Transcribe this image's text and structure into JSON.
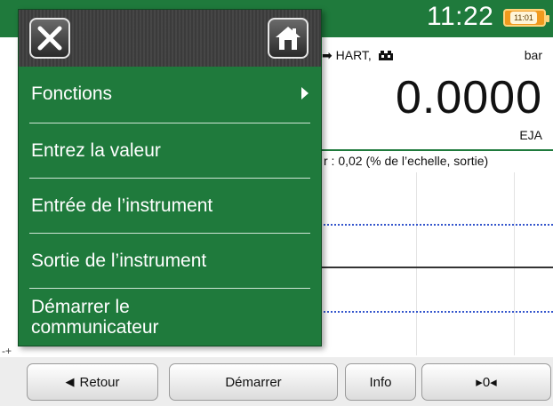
{
  "status": {
    "time": "11:22",
    "battery_label": "11:01",
    "accent_color": "#1f7a3c",
    "battery_color": "#f09a1e"
  },
  "measurement": {
    "protocol": "HART,",
    "unit": "bar",
    "value": "0.0000",
    "device": "EJA",
    "error_text": "r : 0,02 (% de l’echelle, sortie)"
  },
  "menu": {
    "close_icon": "close-icon",
    "home_icon": "home-icon",
    "items": [
      {
        "label": "Fonctions",
        "has_submenu": true
      },
      {
        "label": "Entrez la valeur"
      },
      {
        "label": "Entrée de l’instrument"
      },
      {
        "label": "Sortie de l’instrument"
      },
      {
        "label_line1": "Démarrer le",
        "label_line2": "communicateur"
      }
    ]
  },
  "buttons": {
    "back": "Retour",
    "start": "Démarrer",
    "info": "Info",
    "zero": "▸0◂"
  }
}
